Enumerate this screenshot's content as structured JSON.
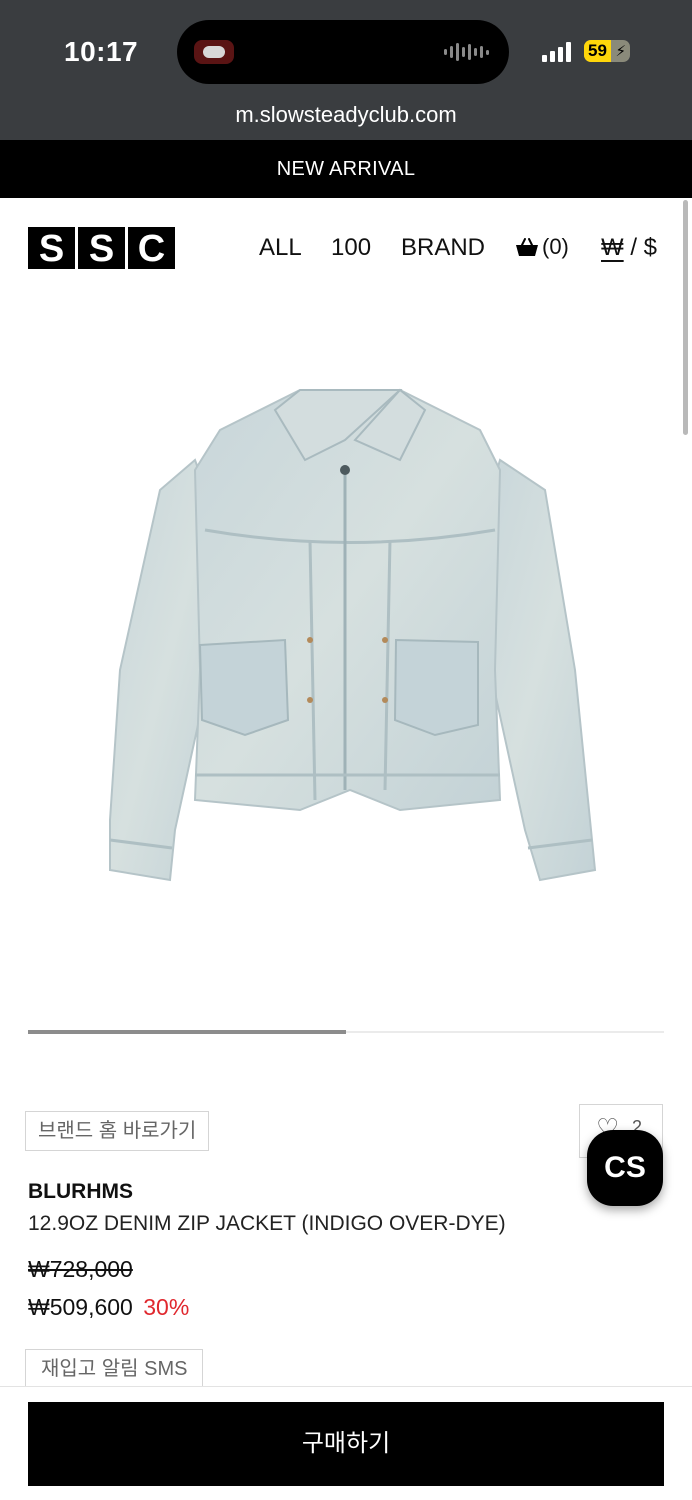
{
  "status_bar": {
    "time": "10:17",
    "battery_level": "59",
    "battery_fraction": 0.59
  },
  "browser": {
    "url": "m.slowsteadyclub.com"
  },
  "banner": {
    "text": "NEW ARRIVAL"
  },
  "header": {
    "logo_letters": [
      "S",
      "S",
      "C"
    ],
    "nav": {
      "all": "ALL",
      "hundred": "100",
      "brand": "BRAND"
    },
    "cart_count": "(0)",
    "currency_won": "₩",
    "currency_separator": " / ",
    "currency_usd": "$"
  },
  "gallery": {
    "progress_fraction": 0.5
  },
  "product": {
    "brand_home_label": "브랜드 홈 바로가기",
    "like_count": "2",
    "cs_label": "CS",
    "brand": "BLURHMS",
    "name": "12.9OZ DENIM ZIP JACKET (INDIGO OVER-DYE)",
    "original_price": "₩728,000",
    "sale_price": "₩509,600",
    "discount": "30%",
    "restock_label": "재입고 알림 SMS"
  },
  "purchase": {
    "buy_label": "구매하기"
  },
  "colors": {
    "status_bar_bg": "#3a3d40",
    "accent_black": "#000000",
    "discount_red": "#e0282e",
    "denim_light": "#cdd9dc"
  },
  "icons": {
    "cart": "shopping-basket-icon",
    "like": "heart-icon",
    "signal": "cellular-signal-icon",
    "battery": "battery-charging-icon",
    "audio": "audio-waveform-icon"
  }
}
